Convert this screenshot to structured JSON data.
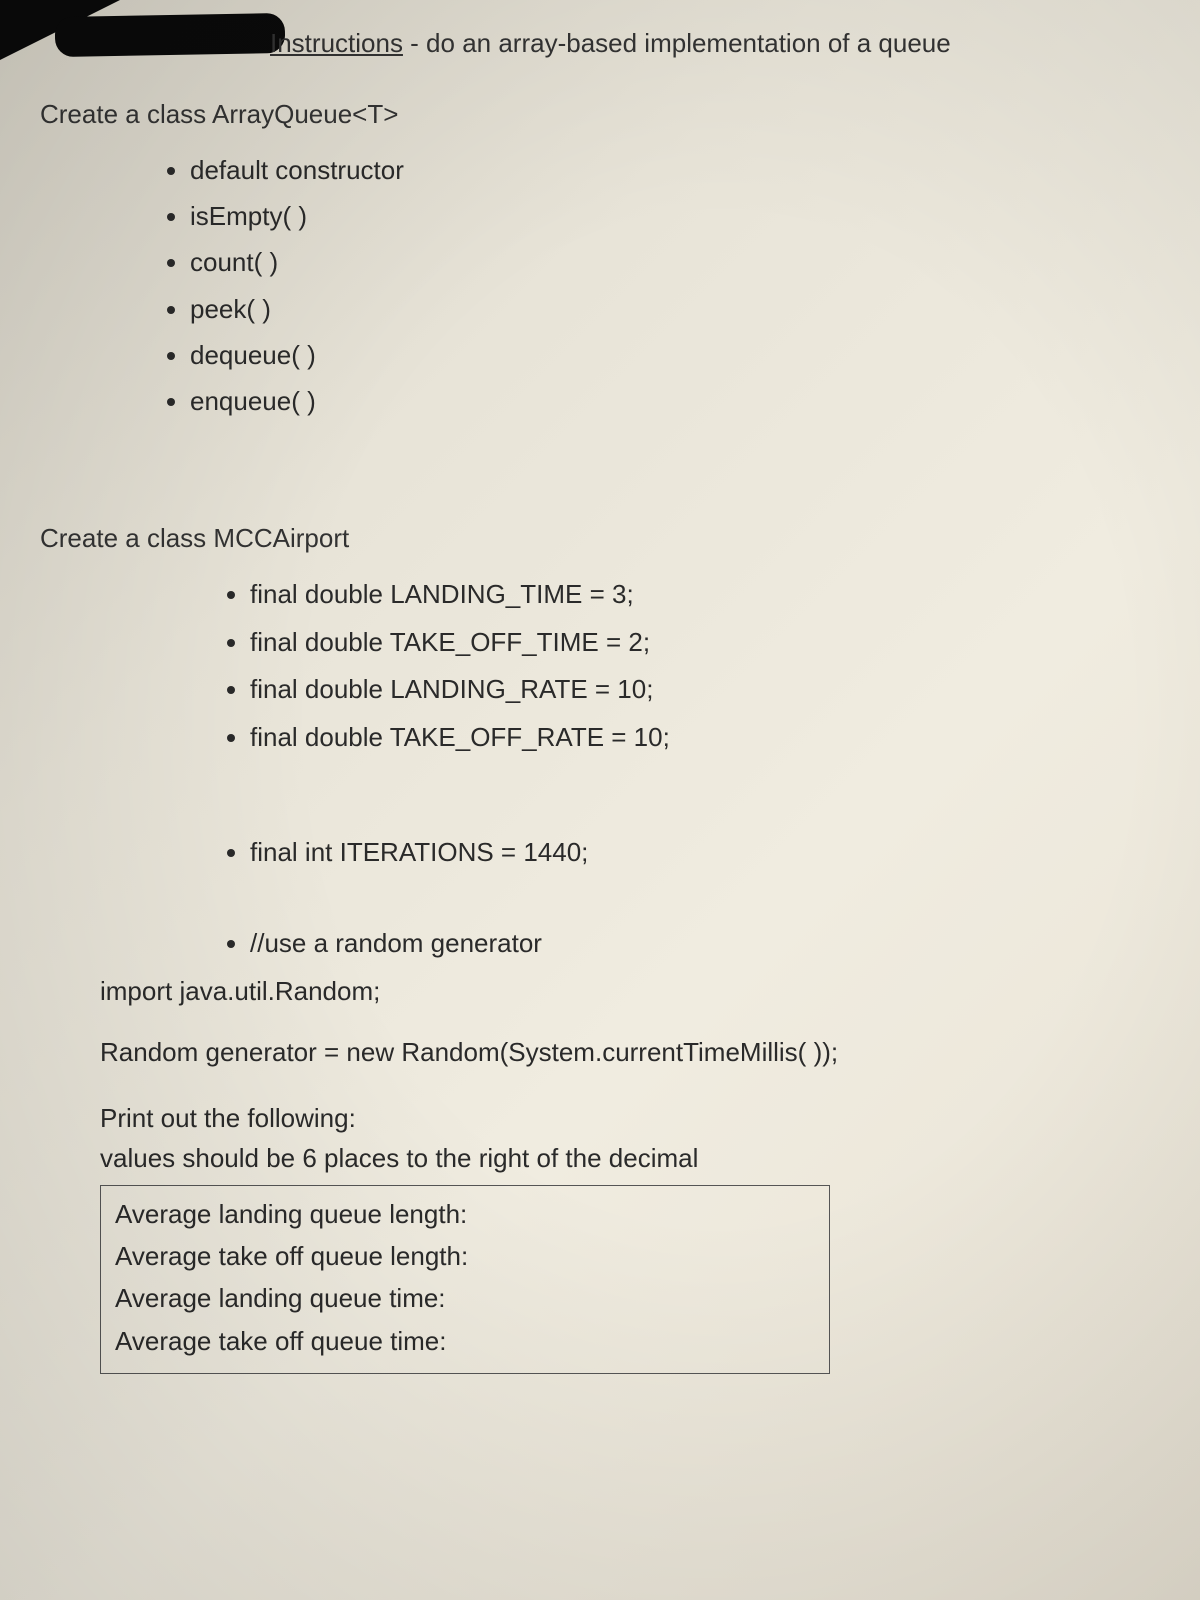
{
  "title": {
    "label": "Instructions",
    "description": " - do an array-based implementation of a queue"
  },
  "section1": {
    "heading": "Create a class ArrayQueue<T>",
    "methods": [
      "default constructor",
      "isEmpty( )",
      "count( )",
      "peek( )",
      "dequeue( )",
      "enqueue( )"
    ]
  },
  "section2": {
    "heading": "Create a class MCCAirport",
    "constants": [
      "final double LANDING_TIME = 3;",
      "final double TAKE_OFF_TIME = 2;",
      "final double LANDING_RATE  = 10;",
      "final double TAKE_OFF_RATE = 10;"
    ],
    "iterations": "final int ITERATIONS = 1440;",
    "random_comment": "//use a random generator",
    "import_line": "import java.util.Random;",
    "generator_line": "Random generator = new Random(System.currentTimeMillis( ));"
  },
  "output": {
    "intro1": "Print out the following:",
    "intro2": "values should be 6 places to the right of the decimal",
    "lines": [
      "Average landing queue length:",
      "Average take off queue length:",
      "Average landing queue time:",
      "Average take off queue time:"
    ]
  }
}
